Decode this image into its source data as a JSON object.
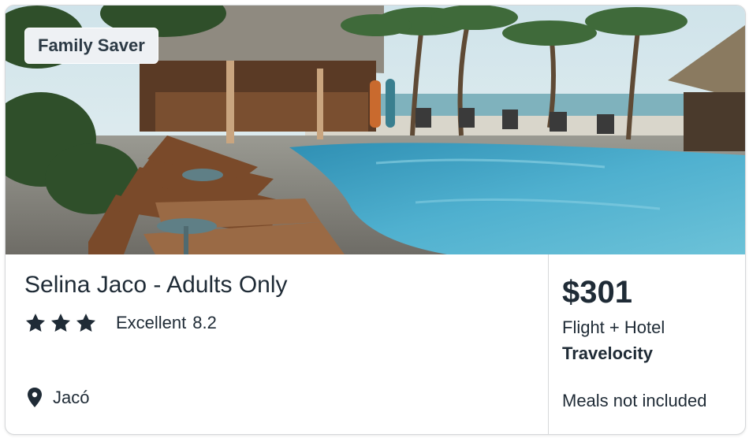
{
  "card": {
    "badge": "Family Saver",
    "hotel_name": "Selina Jaco - Adults Only",
    "star_rating": 3,
    "rating_label": "Excellent",
    "rating_score": "8.2",
    "location": "Jacó",
    "price": "$301",
    "package_type": "Flight + Hotel",
    "provider": "Travelocity",
    "meals_note": "Meals not included"
  },
  "image": {
    "subject": "beach resort pool with palm trees and lounge chairs"
  },
  "icons": {
    "star": "star-icon",
    "location": "map-pin-icon"
  },
  "colors": {
    "text": "#1f2b36",
    "badge_bg": "#eef1f4",
    "border": "#d6d8da",
    "pool": "#3f9fc0"
  }
}
